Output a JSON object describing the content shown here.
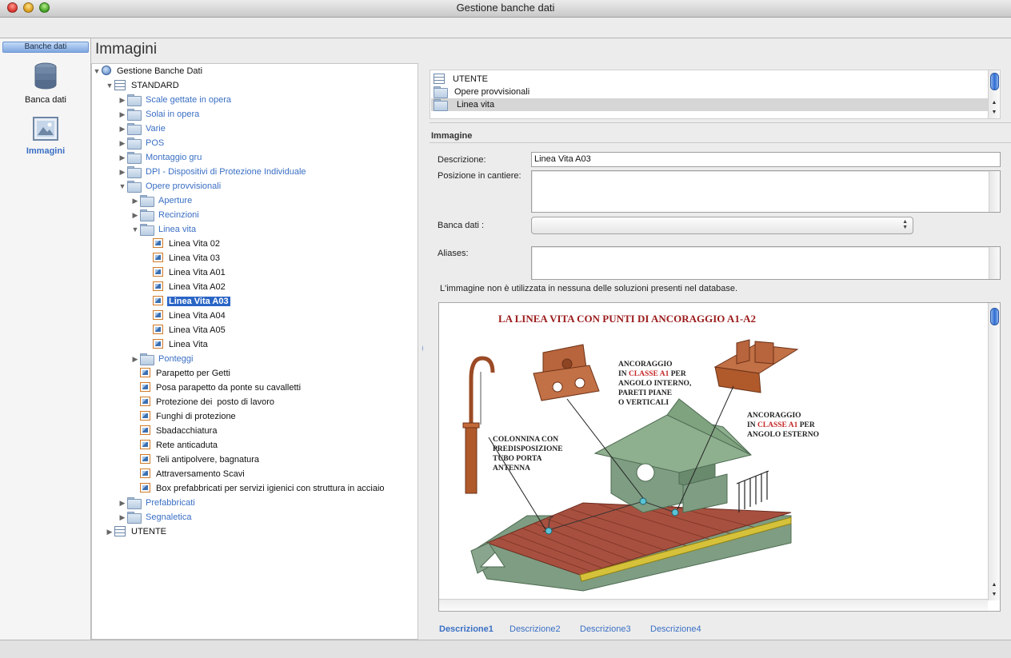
{
  "window": {
    "title": "Gestione banche dati"
  },
  "leftnav": {
    "header": "Banche dati",
    "items": [
      {
        "label": "Banca dati",
        "icon": "database-icon",
        "active": false
      },
      {
        "label": "Immagini",
        "icon": "image-icon",
        "active": true
      }
    ]
  },
  "page": {
    "title": "Immagini"
  },
  "tree": {
    "root": "Gestione Banche Dati",
    "standard": "STANDARD",
    "scale": "Scale gettate in opera",
    "solai": "Solai in opera",
    "varie": "Varie",
    "pos": "POS",
    "gru": "Montaggio gru",
    "dpi": "DPI - Dispositivi di Protezione Individuale",
    "opere": "Opere provvisionali",
    "aperture": "Aperture",
    "recinzioni": "Recinzioni",
    "lineavita": "Linea vita",
    "lv02": "Linea Vita 02",
    "lv03": "Linea Vita 03",
    "lva01": "Linea Vita A01",
    "lva02": "Linea Vita A02",
    "lva03": "Linea Vita A03",
    "lva04": "Linea Vita A04",
    "lva05": "Linea Vita A05",
    "lv": "Linea Vita",
    "ponteggi": "Ponteggi",
    "parapetto": "Parapetto per Getti",
    "posa": "Posa parapetto da ponte su cavalletti",
    "protezione": "Protezione dei  posto di lavoro",
    "funghi": "Funghi di protezione",
    "sbadacchiatura": "Sbadacchiatura",
    "rete": "Rete anticaduta",
    "teli": "Teli antipolvere, bagnatura",
    "attraversamento": "Attraversamento Scavi",
    "box": "Box prefabbricati per servizi igienici con struttura in acciaio",
    "prefabbricati": "Prefabbricati",
    "segnaletica": "Segnaletica",
    "utente": "UTENTE"
  },
  "path_list": [
    {
      "label": "UTENTE",
      "icon": "database-icon"
    },
    {
      "label": "Opere provvisionali",
      "icon": "folder-icon"
    },
    {
      "label": "Linea vita",
      "icon": "folder-icon"
    }
  ],
  "form": {
    "section": "Immagine",
    "descrizione_label": "Descrizione:",
    "descrizione_value": "Linea Vita A03",
    "posizione_label": "Posizione in cantiere:",
    "posizione_value": "",
    "banca_label": "Banca dati :",
    "banca_value": "",
    "aliases_label": "Aliases:",
    "aliases_value": "",
    "info": "L'immagine non è utilizzata in nessuna delle soluzioni presenti nel database."
  },
  "image": {
    "title": "LA LINEA VITA CON PUNTI DI ANCORAGGIO A1-A2",
    "callout_a1_l1": "ANCORAGGIO",
    "callout_a1_l2a": "IN ",
    "callout_a1_l2b": "CLASSE A1",
    "callout_a1_l2c": " PER",
    "callout_a1_l3": "ANGOLO INTERNO,",
    "callout_a1_l4": "PARETI PIANE",
    "callout_a1_l5": "O VERTICALI",
    "callout_ext_l1": "ANCORAGGIO",
    "callout_ext_l2a": "IN ",
    "callout_ext_l2b": "CLASSE A1",
    "callout_ext_l2c": " PER",
    "callout_ext_l3": "ANGOLO ESTERNO",
    "callout_col_l1": "COLONNINA CON",
    "callout_col_l2": "PREDISPOSIZIONE",
    "callout_col_l3": "TUBO PORTA",
    "callout_col_l4": "ANTENNA"
  },
  "tabs": [
    "Descrizione1",
    "Descrizione2",
    "Descrizione3",
    "Descrizione4"
  ],
  "colors": {
    "accent": "#3a6fc4",
    "selection": "#2a64c5",
    "title_red": "#9b1b1b"
  }
}
